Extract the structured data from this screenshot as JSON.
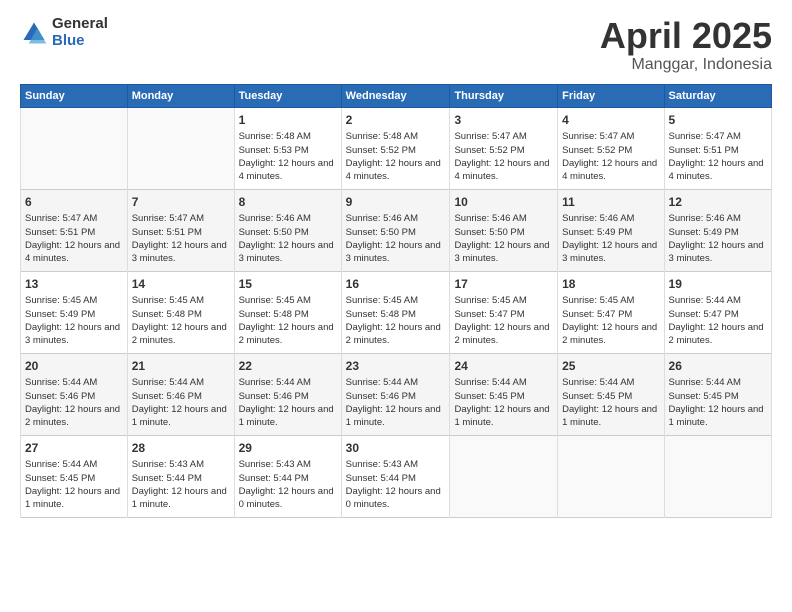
{
  "logo": {
    "general": "General",
    "blue": "Blue"
  },
  "header": {
    "title": "April 2025",
    "location": "Manggar, Indonesia"
  },
  "days_of_week": [
    "Sunday",
    "Monday",
    "Tuesday",
    "Wednesday",
    "Thursday",
    "Friday",
    "Saturday"
  ],
  "weeks": [
    [
      {
        "day": "",
        "sunrise": "",
        "sunset": "",
        "daylight": ""
      },
      {
        "day": "",
        "sunrise": "",
        "sunset": "",
        "daylight": ""
      },
      {
        "day": "1",
        "sunrise": "Sunrise: 5:48 AM",
        "sunset": "Sunset: 5:53 PM",
        "daylight": "Daylight: 12 hours and 4 minutes."
      },
      {
        "day": "2",
        "sunrise": "Sunrise: 5:48 AM",
        "sunset": "Sunset: 5:52 PM",
        "daylight": "Daylight: 12 hours and 4 minutes."
      },
      {
        "day": "3",
        "sunrise": "Sunrise: 5:47 AM",
        "sunset": "Sunset: 5:52 PM",
        "daylight": "Daylight: 12 hours and 4 minutes."
      },
      {
        "day": "4",
        "sunrise": "Sunrise: 5:47 AM",
        "sunset": "Sunset: 5:52 PM",
        "daylight": "Daylight: 12 hours and 4 minutes."
      },
      {
        "day": "5",
        "sunrise": "Sunrise: 5:47 AM",
        "sunset": "Sunset: 5:51 PM",
        "daylight": "Daylight: 12 hours and 4 minutes."
      }
    ],
    [
      {
        "day": "6",
        "sunrise": "Sunrise: 5:47 AM",
        "sunset": "Sunset: 5:51 PM",
        "daylight": "Daylight: 12 hours and 4 minutes."
      },
      {
        "day": "7",
        "sunrise": "Sunrise: 5:47 AM",
        "sunset": "Sunset: 5:51 PM",
        "daylight": "Daylight: 12 hours and 3 minutes."
      },
      {
        "day": "8",
        "sunrise": "Sunrise: 5:46 AM",
        "sunset": "Sunset: 5:50 PM",
        "daylight": "Daylight: 12 hours and 3 minutes."
      },
      {
        "day": "9",
        "sunrise": "Sunrise: 5:46 AM",
        "sunset": "Sunset: 5:50 PM",
        "daylight": "Daylight: 12 hours and 3 minutes."
      },
      {
        "day": "10",
        "sunrise": "Sunrise: 5:46 AM",
        "sunset": "Sunset: 5:50 PM",
        "daylight": "Daylight: 12 hours and 3 minutes."
      },
      {
        "day": "11",
        "sunrise": "Sunrise: 5:46 AM",
        "sunset": "Sunset: 5:49 PM",
        "daylight": "Daylight: 12 hours and 3 minutes."
      },
      {
        "day": "12",
        "sunrise": "Sunrise: 5:46 AM",
        "sunset": "Sunset: 5:49 PM",
        "daylight": "Daylight: 12 hours and 3 minutes."
      }
    ],
    [
      {
        "day": "13",
        "sunrise": "Sunrise: 5:45 AM",
        "sunset": "Sunset: 5:49 PM",
        "daylight": "Daylight: 12 hours and 3 minutes."
      },
      {
        "day": "14",
        "sunrise": "Sunrise: 5:45 AM",
        "sunset": "Sunset: 5:48 PM",
        "daylight": "Daylight: 12 hours and 2 minutes."
      },
      {
        "day": "15",
        "sunrise": "Sunrise: 5:45 AM",
        "sunset": "Sunset: 5:48 PM",
        "daylight": "Daylight: 12 hours and 2 minutes."
      },
      {
        "day": "16",
        "sunrise": "Sunrise: 5:45 AM",
        "sunset": "Sunset: 5:48 PM",
        "daylight": "Daylight: 12 hours and 2 minutes."
      },
      {
        "day": "17",
        "sunrise": "Sunrise: 5:45 AM",
        "sunset": "Sunset: 5:47 PM",
        "daylight": "Daylight: 12 hours and 2 minutes."
      },
      {
        "day": "18",
        "sunrise": "Sunrise: 5:45 AM",
        "sunset": "Sunset: 5:47 PM",
        "daylight": "Daylight: 12 hours and 2 minutes."
      },
      {
        "day": "19",
        "sunrise": "Sunrise: 5:44 AM",
        "sunset": "Sunset: 5:47 PM",
        "daylight": "Daylight: 12 hours and 2 minutes."
      }
    ],
    [
      {
        "day": "20",
        "sunrise": "Sunrise: 5:44 AM",
        "sunset": "Sunset: 5:46 PM",
        "daylight": "Daylight: 12 hours and 2 minutes."
      },
      {
        "day": "21",
        "sunrise": "Sunrise: 5:44 AM",
        "sunset": "Sunset: 5:46 PM",
        "daylight": "Daylight: 12 hours and 1 minute."
      },
      {
        "day": "22",
        "sunrise": "Sunrise: 5:44 AM",
        "sunset": "Sunset: 5:46 PM",
        "daylight": "Daylight: 12 hours and 1 minute."
      },
      {
        "day": "23",
        "sunrise": "Sunrise: 5:44 AM",
        "sunset": "Sunset: 5:46 PM",
        "daylight": "Daylight: 12 hours and 1 minute."
      },
      {
        "day": "24",
        "sunrise": "Sunrise: 5:44 AM",
        "sunset": "Sunset: 5:45 PM",
        "daylight": "Daylight: 12 hours and 1 minute."
      },
      {
        "day": "25",
        "sunrise": "Sunrise: 5:44 AM",
        "sunset": "Sunset: 5:45 PM",
        "daylight": "Daylight: 12 hours and 1 minute."
      },
      {
        "day": "26",
        "sunrise": "Sunrise: 5:44 AM",
        "sunset": "Sunset: 5:45 PM",
        "daylight": "Daylight: 12 hours and 1 minute."
      }
    ],
    [
      {
        "day": "27",
        "sunrise": "Sunrise: 5:44 AM",
        "sunset": "Sunset: 5:45 PM",
        "daylight": "Daylight: 12 hours and 1 minute."
      },
      {
        "day": "28",
        "sunrise": "Sunrise: 5:43 AM",
        "sunset": "Sunset: 5:44 PM",
        "daylight": "Daylight: 12 hours and 1 minute."
      },
      {
        "day": "29",
        "sunrise": "Sunrise: 5:43 AM",
        "sunset": "Sunset: 5:44 PM",
        "daylight": "Daylight: 12 hours and 0 minutes."
      },
      {
        "day": "30",
        "sunrise": "Sunrise: 5:43 AM",
        "sunset": "Sunset: 5:44 PM",
        "daylight": "Daylight: 12 hours and 0 minutes."
      },
      {
        "day": "",
        "sunrise": "",
        "sunset": "",
        "daylight": ""
      },
      {
        "day": "",
        "sunrise": "",
        "sunset": "",
        "daylight": ""
      },
      {
        "day": "",
        "sunrise": "",
        "sunset": "",
        "daylight": ""
      }
    ]
  ]
}
